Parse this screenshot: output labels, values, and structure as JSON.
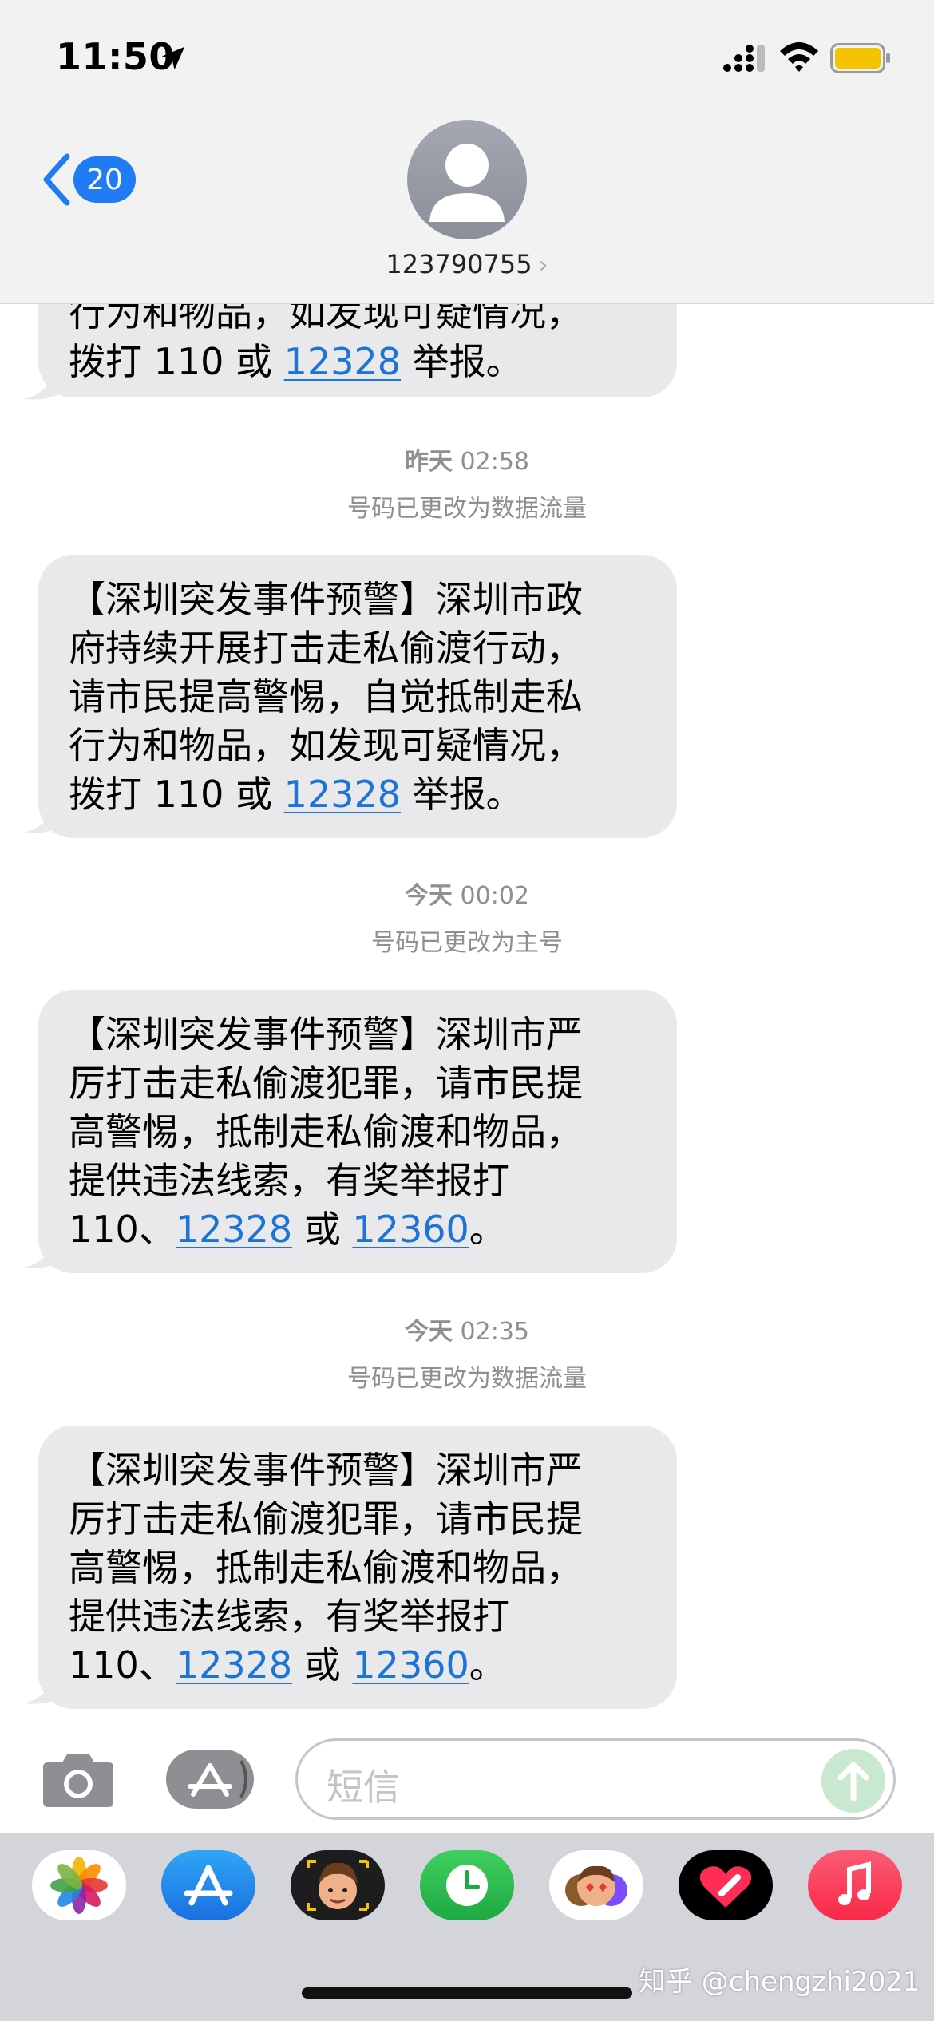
{
  "status_bar": {
    "time": "11:50"
  },
  "header": {
    "unread_count": "20",
    "contact": "123790755",
    "contact_chevron": "›"
  },
  "messages": {
    "m0": {
      "lines": [
        "行为和物品，如发现可疑情况，",
        "拨打 110 或 ",
        "12328",
        " 举报。"
      ]
    },
    "ts1": {
      "day": "昨天",
      "time": " 02:58"
    },
    "note1": "号码已更改为数据流量",
    "m1": {
      "l1": "【深圳突发事件预警】深圳市政",
      "l2": "府持续开展打击走私偷渡行动，",
      "l3": "请市民提高警惕，自觉抵制走私",
      "l4": "行为和物品，如发现可疑情况，",
      "l5a": "拨打 110 或 ",
      "l5b": "12328",
      "l5c": " 举报。"
    },
    "ts2": {
      "day": "今天",
      "time": " 00:02"
    },
    "note2": "号码已更改为主号",
    "m2": {
      "l1": "【深圳突发事件预警】深圳市严",
      "l2": "厉打击走私偷渡犯罪，请市民提",
      "l3": "高警惕，抵制走私偷渡和物品，",
      "l4": "提供违法线索，有奖举报打",
      "l5a": "110、",
      "l5b": "12328",
      "l5c": " 或 ",
      "l5d": "12360",
      "l5e": "。"
    },
    "ts3": {
      "day": "今天",
      "time": " 02:35"
    },
    "note3": "号码已更改为数据流量",
    "m3": {
      "l1": "【深圳突发事件预警】深圳市严",
      "l2": "厉打击走私偷渡犯罪，请市民提",
      "l3": "高警惕，抵制走私偷渡和物品，",
      "l4": "提供违法线索，有奖举报打",
      "l5a": "110、",
      "l5b": "12328",
      "l5c": " 或 ",
      "l5d": "12360",
      "l5e": "。"
    }
  },
  "input": {
    "placeholder": "短信"
  },
  "drawer": {
    "apps": [
      "photos-icon",
      "app-store-icon",
      "memoji-icon",
      "screen-time-icon",
      "animoji-icon",
      "digital-touch-icon",
      "music-icon"
    ]
  },
  "watermark": "知乎 @chengzhi2021",
  "colors": {
    "link": "#1c74d6",
    "badge": "#1f7cf5",
    "bubble": "#e9e9eb"
  }
}
